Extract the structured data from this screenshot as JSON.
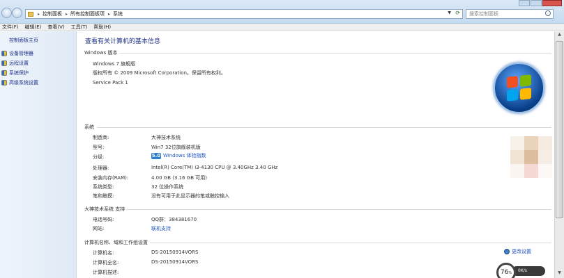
{
  "address_bar": {
    "crumbs": [
      "控制面板",
      "所有控制面板项",
      "系统"
    ],
    "search_placeholder": "搜索控制面板"
  },
  "menu": [
    "文件(F)",
    "编辑(E)",
    "查看(V)",
    "工具(T)",
    "帮助(H)"
  ],
  "sidebar": {
    "home": "控制面板主页",
    "tasks": [
      "设备管理器",
      "远程设置",
      "系统保护",
      "高级系统设置"
    ]
  },
  "main": {
    "title": "查看有关计算机的基本信息",
    "edition": {
      "header": "Windows 版本",
      "name": "Windows 7 旗舰版",
      "copyright": "版权所有 © 2009 Microsoft Corporation。保留所有权利。",
      "service_pack": "Service Pack 1"
    },
    "system": {
      "header": "系统",
      "rows": [
        {
          "label": "制造商:",
          "value": "大神技术系统"
        },
        {
          "label": "型号:",
          "value": "Win7 32位旗舰装机版"
        },
        {
          "label": "分级:",
          "value": "Windows 体验指数",
          "score": "5.0"
        },
        {
          "label": "处理器:",
          "value": "Intel(R) Core(TM) i3-4130 CPU @ 3.40GHz   3.40 GHz"
        },
        {
          "label": "安装内存(RAM):",
          "value": "4.00 GB (3.16 GB 可用)"
        },
        {
          "label": "系统类型:",
          "value": "32 位操作系统"
        },
        {
          "label": "笔和触摸:",
          "value": "没有可用于此显示器的笔或触控输入"
        }
      ]
    },
    "support": {
      "header": "大神技术系统 支持",
      "rows": [
        {
          "label": "电话号码:",
          "value": "QQ群：384381670"
        },
        {
          "label": "网站:",
          "value": "联机支持"
        }
      ]
    },
    "computer": {
      "header": "计算机名称、域和工作组设置",
      "change_label": "更改设置",
      "rows": [
        {
          "label": "计算机名:",
          "value": "DS-20150914VORS"
        },
        {
          "label": "计算机全名:",
          "value": "DS-20150914VORS"
        },
        {
          "label": "计算机描述:",
          "value": ""
        }
      ]
    }
  },
  "meter": {
    "percent": "76",
    "percent_sign": "%",
    "speed": "0K/s"
  }
}
